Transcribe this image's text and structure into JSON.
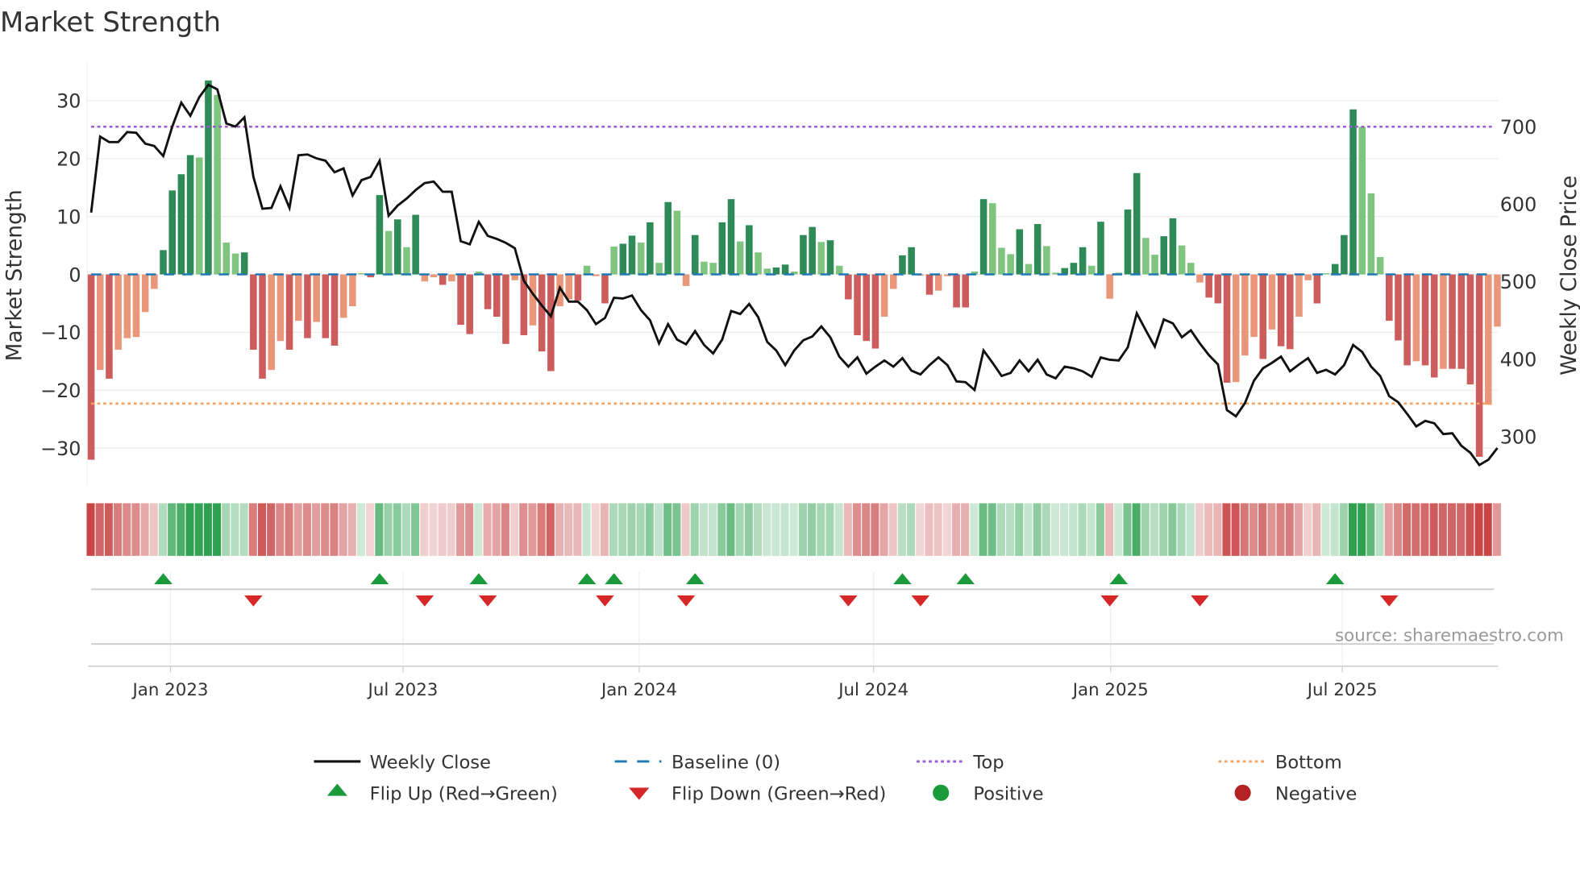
{
  "title": "Market Strength",
  "source": "source: sharemaestro.com",
  "colors": {
    "strong_green": "#2e8b57",
    "weak_green": "#7fc47f",
    "strong_red": "#cd5c5c",
    "weak_red": "#e9967a",
    "close": "#111111",
    "baseline": "#1f77b4",
    "top": "#9b59d6",
    "bottom": "#f4a261",
    "flip_up": "#1a9a3a",
    "flip_down": "#d62728",
    "positive": "#1a9a3a",
    "negative": "#b22222"
  },
  "legend": {
    "weekly_close": "Weekly Close",
    "baseline": "Baseline (0)",
    "top": "Top",
    "bottom": "Bottom",
    "flip_up": "Flip Up (Red→Green)",
    "flip_down": "Flip Down (Green→Red)",
    "positive": "Positive",
    "negative": "Negative"
  },
  "chart_data": {
    "type": "bar",
    "title": "Market Strength",
    "ylabel": "Market Strength",
    "y2label": "Weekly Close Price",
    "ylim": [
      -36,
      37
    ],
    "y2lim": [
      252,
      775
    ],
    "yticks": [
      30,
      20,
      10,
      0,
      -10,
      -20,
      -30
    ],
    "ytick_labels": [
      "30",
      "20",
      "10",
      "0",
      "−10",
      "−20",
      "−30"
    ],
    "y2ticks": [
      700,
      600,
      500,
      400,
      300
    ],
    "y2tick_labels": [
      "700",
      "600",
      "500",
      "400",
      "300"
    ],
    "x_start_week_index": 0,
    "xticks_week_index": [
      8.8,
      34.6,
      60.8,
      86.8,
      113.1,
      138.8
    ],
    "xtick_labels": [
      "Jan 2023",
      "Jul 2023",
      "Jan 2024",
      "Jul 2024",
      "Jan 2025",
      "Jul 2025"
    ],
    "top_level": 25.5,
    "bottom_level": -22.3,
    "baseline": 0,
    "strength": [
      -32,
      -16.5,
      -18,
      -13,
      -11,
      -10.8,
      -6.5,
      -2.5,
      4.2,
      14.5,
      17.3,
      20.6,
      20.2,
      33.5,
      31,
      5.5,
      3.6,
      3.8,
      -13,
      -18,
      -16.5,
      -11.5,
      -13,
      -8,
      -11,
      -8.2,
      -11,
      -12.3,
      -7.5,
      -5.5,
      0.2,
      -0.5,
      13.7,
      7.5,
      9.5,
      4.7,
      10.3,
      -1.2,
      -0.5,
      -1.8,
      -1.2,
      -8.7,
      -10.3,
      0.5,
      -6,
      -7.3,
      -12,
      -1,
      -10.5,
      -8.8,
      -13.3,
      -16.7,
      -5.5,
      -4.3,
      -4.5,
      1.5,
      -0.3,
      -5,
      4.8,
      5.3,
      6.7,
      5.5,
      9,
      2,
      12.5,
      11,
      -2,
      6.8,
      2.2,
      2,
      9,
      13,
      5.7,
      8.5,
      3.8,
      1,
      1.2,
      1.7,
      0.5,
      6.8,
      8.2,
      5.6,
      5.9,
      1.5,
      -4.3,
      -10.5,
      -11.5,
      -12.8,
      -7.3,
      -2.5,
      3.3,
      4.7,
      -0.2,
      -3.5,
      -2.8,
      -0.3,
      -5.7,
      -5.7,
      0.5,
      13,
      12.3,
      4.6,
      3.5,
      7.8,
      1.8,
      8.7,
      4.9,
      0.3,
      1.1,
      2,
      4.7,
      1.5,
      9.1,
      -4.2,
      0.3,
      11.2,
      17.5,
      6.3,
      3.4,
      6.6,
      9.7,
      5,
      2,
      -1.4,
      -4,
      -5,
      -18.7,
      -18.6,
      -14,
      -10.8,
      -14.6,
      -9.5,
      -12.4,
      -12.9,
      -7.3,
      -1,
      -5,
      0.2,
      1.8,
      6.8,
      28.5,
      25.5,
      14,
      3,
      -8,
      -11.4,
      -15.7,
      -15,
      -15.7,
      -17.8,
      -16.3,
      -16.3,
      -16.3,
      -19,
      -31.5,
      -22.5,
      -9
    ],
    "weekly_close": [
      589,
      687,
      680,
      680,
      693,
      692,
      678,
      675,
      662,
      700,
      731,
      714,
      738,
      754,
      748,
      704,
      700,
      712,
      635,
      594,
      595,
      623,
      595,
      663,
      664,
      659,
      656,
      641,
      646,
      611,
      631,
      635,
      656,
      585,
      598,
      607,
      618,
      627,
      629,
      616,
      616,
      552,
      548,
      577,
      559,
      555,
      550,
      543,
      501,
      484,
      469,
      455,
      492,
      474,
      474,
      463,
      445,
      453,
      479,
      478,
      482,
      463,
      450,
      420,
      445,
      425,
      419,
      436,
      418,
      407,
      425,
      462,
      458,
      471,
      454,
      422,
      411,
      392,
      411,
      424,
      429,
      442,
      428,
      403,
      390,
      402,
      381,
      390,
      398,
      390,
      401,
      385,
      380,
      392,
      402,
      392,
      371,
      370,
      360,
      411,
      395,
      378,
      382,
      398,
      384,
      399,
      380,
      375,
      390,
      388,
      384,
      377,
      402,
      399,
      398,
      415,
      459,
      437,
      416,
      451,
      446,
      428,
      437,
      420,
      405,
      393,
      334,
      326,
      343,
      372,
      388,
      395,
      403,
      384,
      393,
      401,
      382,
      386,
      380,
      392,
      418,
      409,
      390,
      378,
      352,
      344,
      329,
      313,
      320,
      317,
      303,
      304,
      288,
      279,
      263,
      270,
      285
    ],
    "flip_up_week_index": [
      8,
      32,
      43,
      55,
      58,
      67,
      90,
      97,
      114,
      138
    ],
    "flip_down_week_index": [
      18,
      37,
      44,
      57,
      66,
      84,
      92,
      113,
      123,
      144
    ]
  }
}
